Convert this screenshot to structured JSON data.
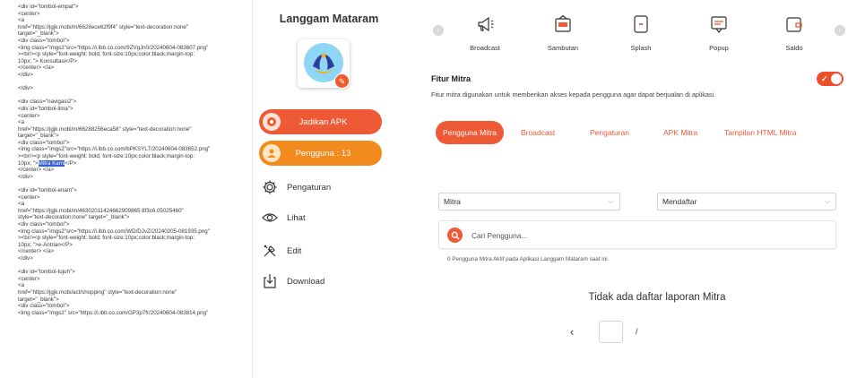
{
  "code": {
    "lines": [
      "<div id=\"tombol-empat\">",
      "<center>",
      "<a",
      "href=\"https://jgjk.mobi/m/6628ece62f9f4\" style=\"text-decoration:none\"",
      "target=\"_blank\">",
      "<div class=\"tombol\">",
      "<img class=\"imgs2\"src=\"https://i.ibb.co.com/9ZVgJn0/20240604-083607.png\"",
      "><br/><p style=\"font-weight: bold; font-size:10px;color:black;margin-top:",
      "10px; \"> Konsultasi</P>",
      "</center> </a>",
      "</div>",
      "",
      "</div>",
      "",
      "<div class=\"navigasi2\">",
      "<div id=\"tombol-lima\">",
      "<center>",
      "<a",
      "href=\"https://jgjk.mobi/m/66288256eca58\" style=\"text-decoration:none\"",
      "target=\"_blank\">",
      "<div class=\"tombol\">",
      "<img class=\"imgs2\"src=\"https://i.ibb.co.com/bPKSYL7/20240604-083652.png\"",
      "><br/><p style=\"font-weight: bold; font-size:10px;color:black;margin-top:",
      "10px; \">",
      "</center> </a>",
      "</div>",
      "",
      "<div id=\"tombol-enam\">",
      "<center>",
      "<a",
      "href=\"https://jgjk.mobi/m/46302011424662909865 8f3c6.05025460\"",
      "style=\"text-decoration:none\" target=\"_blank\">",
      "<div class=\"tombol\">",
      "<img class=\"imgs2\"src=\"https://i.ibb.co.com/WD/DJvZ/20240205-081935.png\"",
      "><br/><p style=\"font-weight: bold; font-size:10px;color:black;margin-top:",
      "10px; \">e-Antrian</P>",
      "</center> </a>",
      "</div>",
      "",
      "<div id=\"tombol-tujuh\">",
      "<center>",
      "<a",
      "href=\"https://jgjk.mobi/act/shopping\" style=\"text-decoration:none\"",
      "target=\"_blank\">",
      "<div class=\"tombol\">",
      "<img class=\"imgs2\" src=\"https://i.ibb.co.com/GP3p7fr/20240604-083814.png\""
    ],
    "selected_text": "Mitra Kami",
    "after_selected": "</P>"
  },
  "sidebar": {
    "app_title": "Langgam Mataram",
    "apk_button": "Jadikan APK",
    "users_button": "Pengguna : 13",
    "menu": [
      {
        "label": "Pengaturan",
        "icon": "gear-icon"
      },
      {
        "label": "Lihat",
        "icon": "eye-icon"
      },
      {
        "label": "Edit",
        "icon": "tools-icon"
      },
      {
        "label": "Download",
        "icon": "download-icon"
      }
    ]
  },
  "nav": {
    "items": [
      {
        "label": "Broadcast",
        "icon": "megaphone-icon"
      },
      {
        "label": "Sambutan",
        "icon": "welcome-icon"
      },
      {
        "label": "Splash",
        "icon": "splash-icon"
      },
      {
        "label": "Popup",
        "icon": "popup-icon"
      },
      {
        "label": "Saldo",
        "icon": "wallet-icon"
      }
    ]
  },
  "fitur": {
    "title": "Fitur Mitra",
    "enabled": true,
    "description": "Fitur mitra digunakan untuk memberikan akses kepada pengguna agar dapat berjualan di aplikasi."
  },
  "tabs": [
    "Pengguna Mitra",
    "Broadcast",
    "Pengaturan",
    "APK Mitra",
    "Tampilan HTML Mitra"
  ],
  "filters": {
    "mitra": "Mitra",
    "mendaftar": "Mendaftar"
  },
  "search": {
    "placeholder": "Cari Pengguna...",
    "value": ""
  },
  "active_count_text": "0 Pengguna Mitra Aktif pada Aplikasi Langgam Mataram saat ini.",
  "empty_report_text": "Tidak ada daftar laporan Mitra",
  "pagination": {
    "prev": "‹",
    "current": "",
    "separator": "/"
  },
  "colors": {
    "accent": "#ef5a36",
    "users_button": "#f28a1e",
    "logo_bg": "#8fd5f5"
  }
}
